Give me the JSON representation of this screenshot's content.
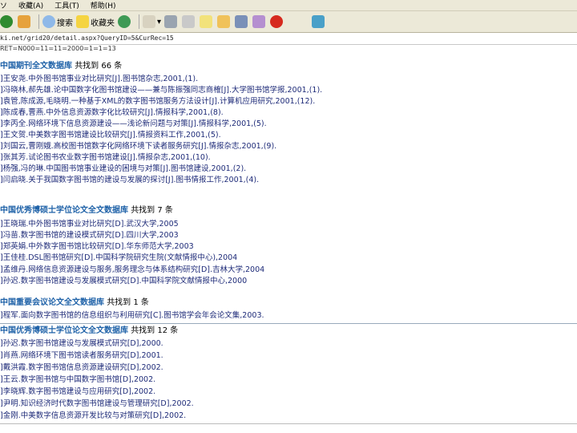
{
  "menu": {
    "items": [
      "ソ",
      "收藏(A)",
      "工具(T)",
      "帮助(H)"
    ]
  },
  "toolbar": {
    "search_label": "搜索",
    "favorites_label": "收藏夹",
    "icons": [
      "back-icon",
      "home-icon",
      "search-icon",
      "favorites-star-icon",
      "media-icon",
      "mail-icon",
      "print-icon",
      "edit-icon",
      "discuss-icon",
      "folder-icon",
      "research-icon",
      "messenger-icon",
      "red-app-icon",
      "people-icon"
    ]
  },
  "address": {
    "url": "ki.net/grid20/detail.aspx?QueryID=5&CurRec=15"
  },
  "content": {
    "cut_line": "RET=N000=11=11=2000=1=1=13",
    "sections": [
      {
        "title": "中国期刊全文数据库",
        "count": "共找到 66 条",
        "items": [
          "]王安尧.中外图书馆事业对比研究[J].图书馆杂志,2001,(1).",
          "]冯晓林,郝先雄.论中国数字化图书馆建设——兼与陈振强同志商榷[J].大学图书馆学报,2001,(1).",
          "]袁管,陈成源,毛晓明.一种基于XML的数字图书馆服务方法设计[J].计算机应用研究,2001,(12).",
          "]陈成春,曹燕.中外信息资源数字化比较研究[J].情报科学,2001,(8).",
          "]李丙全.网络环境下信息资源建设——浅论新问题与对策[J].情报科学,2001,(5).",
          "]王文贺.中美数字图书馆建设比较研究[J].情报资料工作,2001,(5).",
          "]刘国云,曹刚娥.高校图书馆数字化网络环境下读者服务研究[J].情报杂志,2001,(9).",
          "]张其芳.试论图书农业数字图书馆建设[J].情报杂志,2001,(10).",
          "]杨强,冯的琳.中国图书馆事业建设的困境与对策[J].图书馆建设,2001,(2).",
          "]闫启晓.关于我国数字图书馆的建设与发展的探讨[J].图书情报工作,2001,(4)."
        ]
      },
      {
        "title": "中国优秀博硕士学位论文全文数据库",
        "count": "共找到 7 条",
        "items": [
          "]王晓瑞.中外图书馆事业对比研究[D].武汉大学,2005",
          "]冯苗.数字图书馆的建设模式研究[D].四川大学,2003",
          "]郑英娟.中外数字图书馆比较研究[D].华东师范大学,2003",
          "]王佳桂.DSL图书馆研究[D].中国科学院研究生院(文献情报中心),2004",
          "]孟维丹.网络信息资源建设与服务,服务理念与体系结构研究[D].吉林大学,2004",
          "]孙迟.数字图书馆建设与发展模式研究[D].中国科学院文献情报中心,2000"
        ]
      },
      {
        "title": "中国重要会议论文全文数据库",
        "count": "共找到 1 条",
        "items": [
          "]程军.面向数字图书馆的信息组织与利用研究[C].图书馆学会年会论文集,2003."
        ]
      },
      {
        "title": "中国优秀博硕士学位论文全文数据库",
        "count": "共找到 12 条",
        "items": [
          "]孙迟.数字图书馆建设与发展模式研究[D],2000.",
          "]肖燕.网络环境下图书馆读者服务研究[D],2001.",
          "]戴洪霞.数字图书馆信息资源建设研究[D],2002.",
          "]王云.数字图书馆与中国数字图书馆[D],2002.",
          "]李晓辉.数字图书馆建设与应用研究[D],2002.",
          "]尹明.知识经济时代数字图书馆建设与管理研究[D],2002.",
          "]金刚.中美数字信息资源开发比较与对策研究[D],2002."
        ]
      }
    ]
  }
}
